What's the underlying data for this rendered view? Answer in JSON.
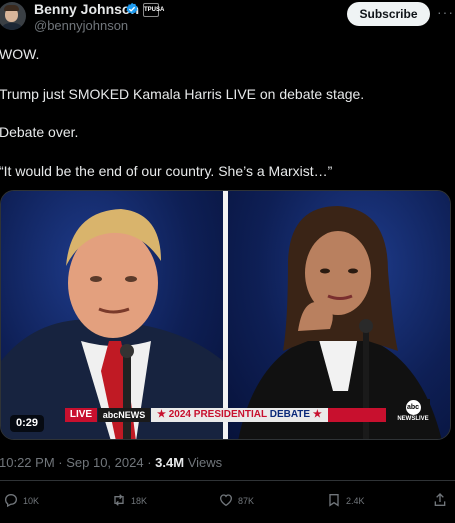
{
  "author": {
    "name": "Benny Johnson",
    "handle": "@bennyjohnson",
    "affiliation_badge": "TPUSA"
  },
  "header": {
    "subscribe_label": "Subscribe",
    "more_label": "···"
  },
  "tweet": {
    "lines": [
      "WOW.",
      "Trump just SMOKED Kamala Harris LIVE on debate stage.",
      "Debate over.",
      "“It would be the end of our country. She’s a Marxist…”"
    ]
  },
  "video": {
    "duration": "0:29",
    "lower_third": {
      "live": "LIVE",
      "network": "abcNEWS",
      "title_prefix": "★ 2024 PRESIDENTIAL ",
      "title_word": "DEBATE",
      "title_suffix": " ★"
    },
    "logo": {
      "circle": "abc",
      "text": "NEWSLIVE"
    }
  },
  "meta": {
    "time": "10:22 PM",
    "date": "Sep 10, 2024",
    "views_count": "3.4M",
    "views_label": "Views"
  },
  "actions": {
    "replies": "10K",
    "reposts": "18K",
    "likes": "87K",
    "bookmarks": "2.4K"
  },
  "colors": {
    "background": "#000000",
    "text": "#e7e9ea",
    "secondary": "#71767b",
    "verified": "#1d9bf0",
    "live_red": "#c8102e"
  }
}
